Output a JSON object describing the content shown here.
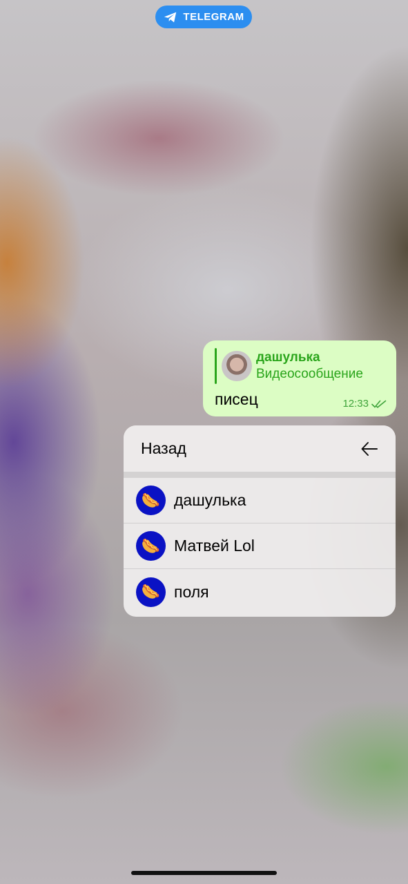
{
  "app": {
    "name": "TELEGRAM",
    "icon": "telegram-plane-icon",
    "pill_color": "#2c8ef0"
  },
  "message": {
    "reply_name": "дашулька",
    "reply_type": "Видеосообщение",
    "text": "писец",
    "time": "12:33",
    "status_icon": "double-check-icon",
    "bubble_color": "#dcfdc4",
    "accent_color": "#2aa51b"
  },
  "menu": {
    "back_label": "Назад",
    "back_icon": "arrow-left-icon",
    "items": [
      {
        "label": "дашулька",
        "avatar_icon": "hotdog-icon"
      },
      {
        "label": "Матвей Lol",
        "avatar_icon": "hotdog-icon"
      },
      {
        "label": "поля",
        "avatar_icon": "hotdog-icon"
      }
    ],
    "avatar_color": "#0a12c4"
  }
}
